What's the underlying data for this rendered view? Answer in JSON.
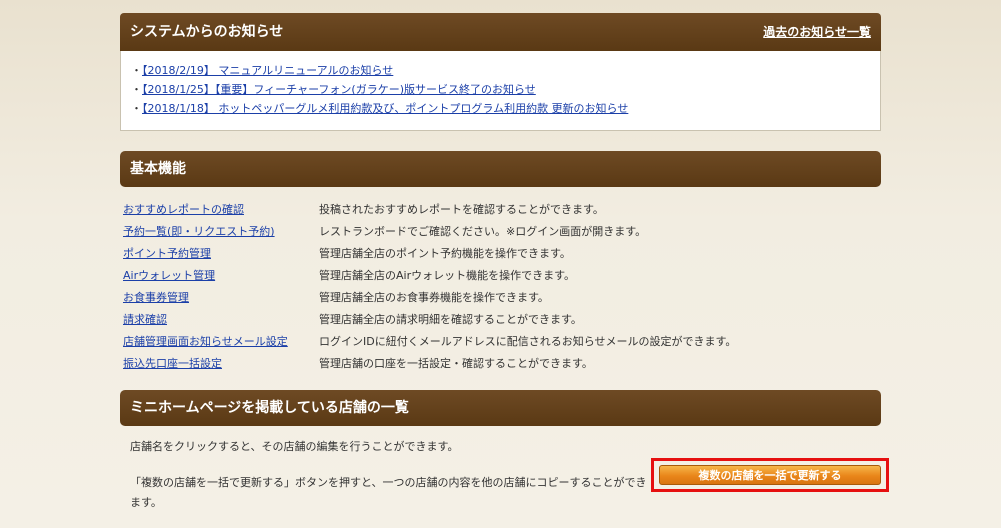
{
  "notice": {
    "title": "システムからのお知らせ",
    "past_link": "過去のお知らせ一覧",
    "items": [
      {
        "bullet": "・",
        "text": "【2018/2/19】 マニュアルリニューアルのお知らせ"
      },
      {
        "bullet": "・",
        "text": "【2018/1/25】【重要】フィーチャーフォン(ガラケー)版サービス終了のお知らせ"
      },
      {
        "bullet": "・",
        "text": "【2018/1/18】 ホットペッパーグルメ利用約款及び、ポイントプログラム利用約款 更新のお知らせ"
      }
    ]
  },
  "basic": {
    "title": "基本機能",
    "rows": [
      {
        "link": "おすすめレポートの確認",
        "desc": "投稿されたおすすめレポートを確認することができます。"
      },
      {
        "link": "予約一覧(即・リクエスト予約)",
        "desc": "レストランボードでご確認ください。※ログイン画面が開きます。"
      },
      {
        "link": "ポイント予約管理",
        "desc": "管理店舗全店のポイント予約機能を操作できます。"
      },
      {
        "link": "Airウォレット管理",
        "desc": "管理店舗全店のAirウォレット機能を操作できます。"
      },
      {
        "link": "お食事券管理",
        "desc": "管理店舗全店のお食事券機能を操作できます。"
      },
      {
        "link": "請求確認",
        "desc": "管理店舗全店の請求明細を確認することができます。"
      },
      {
        "link": "店舗管理画面お知らせメール設定",
        "desc": "ログインIDに紐付くメールアドレスに配信されるお知らせメールの設定ができます。"
      },
      {
        "link": "振込先口座一括設定",
        "desc": "管理店舗の口座を一括設定・確認することができます。"
      }
    ]
  },
  "shops": {
    "title": "ミニホームページを掲載している店舗の一覧",
    "text1": "店舗名をクリックすると、その店舗の編集を行うことができます。",
    "text2": "「複数の店舗を一括で更新する」ボタンを押すと、一つの店舗の内容を他の店舗にコピーすることができます。",
    "bulk_button": "複数の店舗を一括で更新する"
  }
}
